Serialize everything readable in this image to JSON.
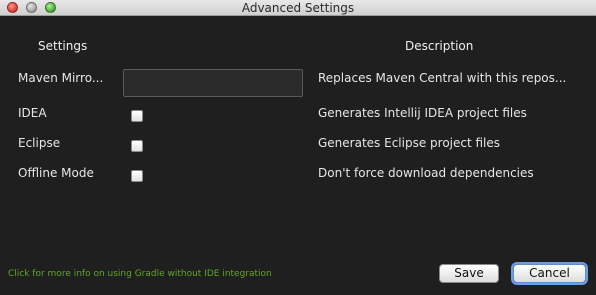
{
  "window": {
    "title": "Advanced Settings"
  },
  "table": {
    "headers": {
      "settings": "Settings",
      "description": "Description"
    },
    "rows": [
      {
        "label": "Maven Mirro...",
        "control": "text-input",
        "value": "",
        "description": "Replaces Maven Central with this repos..."
      },
      {
        "label": "IDEA",
        "control": "checkbox",
        "checked": false,
        "description": "Generates Intellij IDEA project files"
      },
      {
        "label": "Eclipse",
        "control": "checkbox",
        "checked": false,
        "description": "Generates Eclipse project files"
      },
      {
        "label": "Offline Mode",
        "control": "checkbox",
        "checked": false,
        "description": "Don't force download dependencies"
      }
    ]
  },
  "footer": {
    "info_link": "Click for more info on using Gradle without IDE integration",
    "save_label": "Save",
    "cancel_label": "Cancel"
  },
  "colors": {
    "background": "#1f1f1f",
    "link": "#5fa81f",
    "focus_ring": "#6d9ee0"
  }
}
